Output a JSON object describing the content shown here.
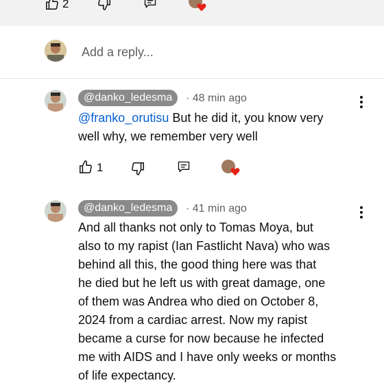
{
  "top_actions": {
    "like_count": "2"
  },
  "reply_box": {
    "placeholder": "Add a reply..."
  },
  "comments": [
    {
      "handle": "@danko_ledesma",
      "time": "48 min ago",
      "mention": "@franko_orutisu",
      "lines": [
        "But he did it, you know very",
        "well why, we remember very well"
      ],
      "like_count": "1"
    },
    {
      "handle": "@danko_ledesma",
      "time": "41 min ago",
      "lines": [
        "And all thanks not only to Tomas Moya, but",
        "also to my rapist (Ian Fastlicht Nava) who was",
        "behind all this, the good thing here was that",
        "he died but he left us with great damage, one",
        "of them was Andrea who died on October 8,",
        "2024 from a cardiac arrest. Now my rapist",
        "became a curse for now because he infected",
        "me with AIDS and I have only weeks or months",
        "of life expectancy."
      ]
    }
  ],
  "colors": {
    "heart": "#e62117",
    "link": "#065fd4",
    "chip": "#8a8a8a"
  },
  "icons": [
    "thumbs-up-icon",
    "thumbs-down-icon",
    "reply-icon",
    "creator-heart-icon",
    "more-vert-icon"
  ]
}
